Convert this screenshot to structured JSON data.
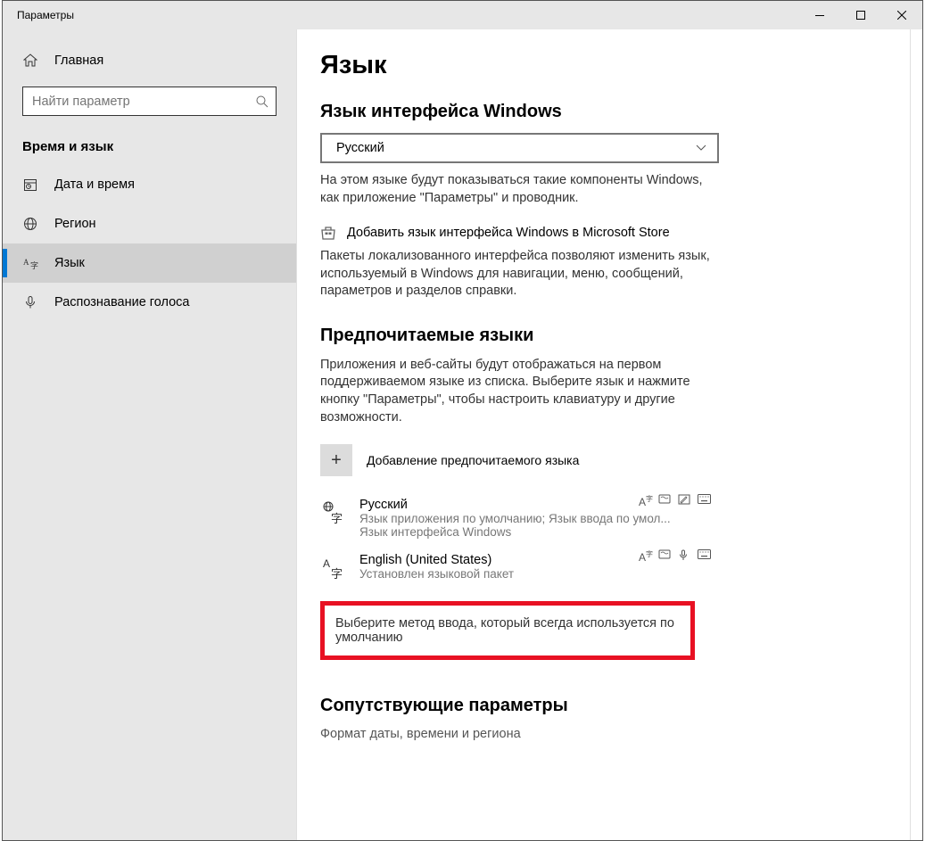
{
  "window": {
    "title": "Параметры"
  },
  "sidebar": {
    "home_label": "Главная",
    "search_placeholder": "Найти параметр",
    "section_label": "Время и язык",
    "items": [
      {
        "icon": "calendar-icon",
        "label": "Дата и время"
      },
      {
        "icon": "globe-icon",
        "label": "Регион"
      },
      {
        "icon": "language-icon",
        "label": "Язык"
      },
      {
        "icon": "mic-icon",
        "label": "Распознавание голоса"
      }
    ]
  },
  "main": {
    "page_title": "Язык",
    "display_lang_title": "Язык интерфейса Windows",
    "display_lang_selected": "Русский",
    "display_lang_desc": "На этом языке будут показываться такие компоненты Windows, как приложение \"Параметры\" и проводник.",
    "store_link_text": "Добавить язык интерфейса Windows в Microsoft Store",
    "store_desc": "Пакеты локализованного интерфейса позволяют изменить язык, используемый в Windows для навигации, меню, сообщений, параметров и разделов справки.",
    "preferred_title": "Предпочитаемые языки",
    "preferred_desc": "Приложения и веб-сайты будут отображаться на первом поддерживаемом языке из списка. Выберите язык и нажмите кнопку \"Параметры\", чтобы настроить клавиатуру и другие возможности.",
    "add_lang_label": "Добавление предпочитаемого языка",
    "languages": [
      {
        "name": "Русский",
        "sub1": "Язык приложения по умолчанию; Язык ввода по умол...",
        "sub2": "Язык интерфейса Windows"
      },
      {
        "name": "English (United States)",
        "sub1": "Установлен языковой пакет",
        "sub2": ""
      }
    ],
    "input_method_link": "Выберите метод ввода, который всегда используется по умолчанию",
    "related_title": "Сопутствующие параметры",
    "related_link": "Формат даты, времени и региона"
  }
}
